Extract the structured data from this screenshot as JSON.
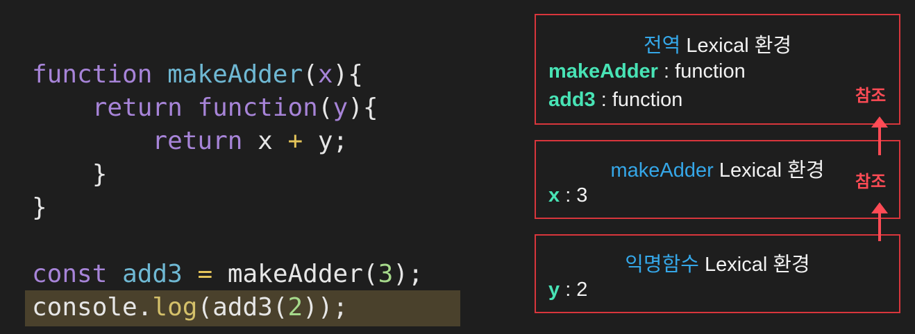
{
  "code": {
    "lines": [
      [
        {
          "t": "kw",
          "v": "function"
        },
        {
          "t": "plain",
          "v": " "
        },
        {
          "t": "fn",
          "v": "makeAdder"
        },
        {
          "t": "plain",
          "v": "("
        },
        {
          "t": "param",
          "v": "x"
        },
        {
          "t": "plain",
          "v": "){"
        }
      ],
      [
        {
          "t": "plain",
          "v": "    "
        },
        {
          "t": "kw",
          "v": "return"
        },
        {
          "t": "plain",
          "v": " "
        },
        {
          "t": "kw",
          "v": "function"
        },
        {
          "t": "plain",
          "v": "("
        },
        {
          "t": "param",
          "v": "y"
        },
        {
          "t": "plain",
          "v": "){"
        }
      ],
      [
        {
          "t": "plain",
          "v": "        "
        },
        {
          "t": "kw",
          "v": "return"
        },
        {
          "t": "plain",
          "v": " x "
        },
        {
          "t": "op",
          "v": "+"
        },
        {
          "t": "plain",
          "v": " y;"
        }
      ],
      [
        {
          "t": "plain",
          "v": "    }"
        }
      ],
      [
        {
          "t": "plain",
          "v": "}"
        }
      ],
      [],
      [
        {
          "t": "kw",
          "v": "const"
        },
        {
          "t": "plain",
          "v": " "
        },
        {
          "t": "var",
          "v": "add3"
        },
        {
          "t": "plain",
          "v": " "
        },
        {
          "t": "op",
          "v": "="
        },
        {
          "t": "plain",
          "v": " makeAdder("
        },
        {
          "t": "num",
          "v": "3"
        },
        {
          "t": "plain",
          "v": ");"
        }
      ],
      [
        {
          "t": "plain",
          "v": "console."
        },
        {
          "t": "method",
          "v": "log"
        },
        {
          "t": "plain",
          "v": "(add3("
        },
        {
          "t": "num",
          "v": "2"
        },
        {
          "t": "plain",
          "v": "));"
        }
      ]
    ],
    "highlighted_line": 8
  },
  "diagram": {
    "global_env": {
      "title_highlight": "전역",
      "title_rest": " Lexical 환경",
      "rows": [
        {
          "key": "makeAdder",
          "value": " : function"
        },
        {
          "key": "add3",
          "value": " : function"
        }
      ]
    },
    "make_adder_env": {
      "title_highlight": "makeAdder",
      "title_rest": " Lexical 환경",
      "rows": [
        {
          "key": "x",
          "value": " : 3"
        }
      ]
    },
    "anon_env": {
      "title_highlight": "익명함수",
      "title_rest": " Lexical 환경",
      "rows": [
        {
          "key": "y",
          "value": " : 2"
        }
      ]
    },
    "ref_label_top": "참조",
    "ref_label_bottom": "참조"
  },
  "colors": {
    "background": "#1e1e1e",
    "box_border": "#d9363c",
    "title_highlight": "#35a7e8",
    "key": "#48e3b5",
    "reference": "#ff4b55",
    "highlight_row": "#4a412c"
  }
}
